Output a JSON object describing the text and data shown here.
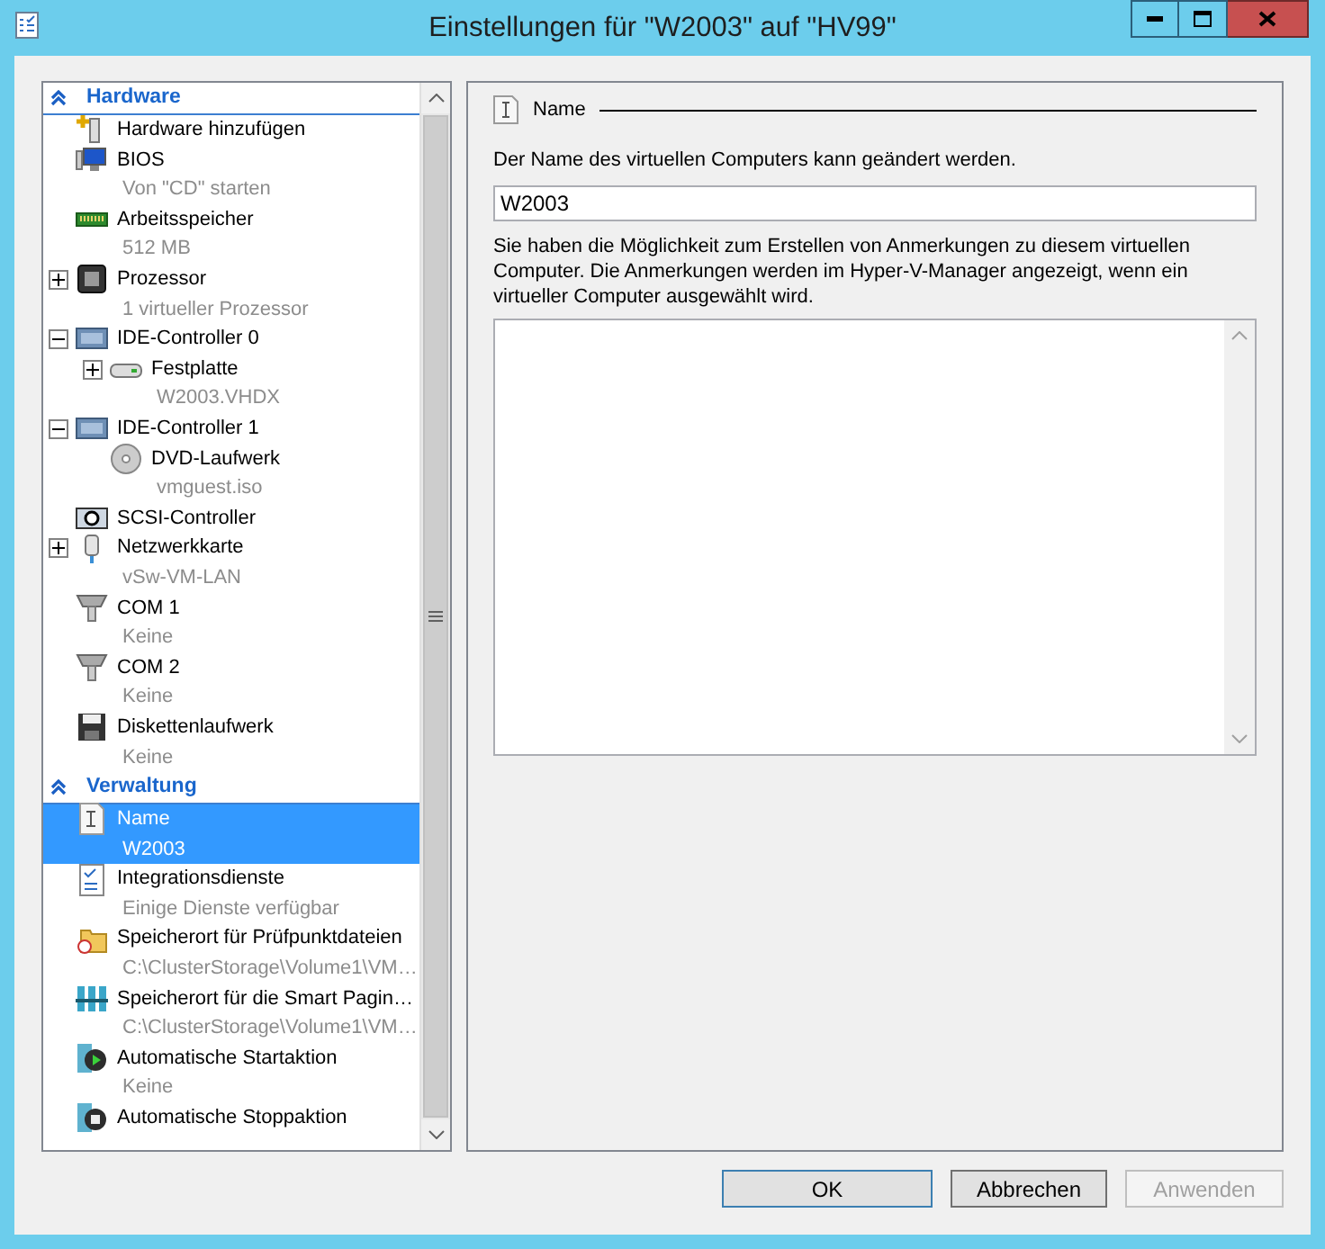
{
  "window": {
    "title": "Einstellungen für \"W2003\" auf \"HV99\""
  },
  "sidebar": {
    "sections": [
      {
        "title": "Hardware",
        "expanded": true,
        "items": [
          {
            "kind": "add-hardware",
            "label": "Hardware hinzufügen",
            "selected": false
          },
          {
            "kind": "bios",
            "label": "BIOS",
            "detail": "Von \"CD\" starten",
            "selected": false
          },
          {
            "kind": "memory",
            "label": "Arbeitsspeicher",
            "detail": "512 MB",
            "selected": false
          },
          {
            "kind": "processor",
            "label": "Prozessor",
            "detail": "1 virtueller Prozessor",
            "expanded": false,
            "selected": false
          },
          {
            "kind": "controller",
            "label": "IDE-Controller 0",
            "expanded": true,
            "selected": false,
            "children": [
              {
                "kind": "disk",
                "label": "Festplatte",
                "detail": "W2003.VHDX",
                "expanded": false,
                "selected": false
              }
            ]
          },
          {
            "kind": "controller",
            "label": "IDE-Controller 1",
            "expanded": true,
            "selected": false,
            "children": [
              {
                "kind": "dvd",
                "label": "DVD-Laufwerk",
                "detail": "vmguest.iso",
                "selected": false
              }
            ]
          },
          {
            "kind": "scsi",
            "label": "SCSI-Controller",
            "selected": false
          },
          {
            "kind": "network",
            "label": "Netzwerkkarte",
            "detail": "vSw-VM-LAN",
            "expanded": false,
            "selected": false
          },
          {
            "kind": "com",
            "label": "COM 1",
            "detail": "Keine",
            "selected": false
          },
          {
            "kind": "com",
            "label": "COM 2",
            "detail": "Keine",
            "selected": false
          },
          {
            "kind": "floppy",
            "label": "Diskettenlaufwerk",
            "detail": "Keine",
            "selected": false
          }
        ]
      },
      {
        "title": "Verwaltung",
        "expanded": true,
        "items": [
          {
            "kind": "name",
            "label": "Name",
            "detail": "W2003",
            "selected": true
          },
          {
            "kind": "integration",
            "label": "Integrationsdienste",
            "detail": "Einige Dienste verfügbar",
            "selected": false
          },
          {
            "kind": "checkpoint",
            "label": "Speicherort für Prüfpunktdateien",
            "detail": "C:\\ClusterStorage\\Volume1\\VM…",
            "selected": false
          },
          {
            "kind": "paging",
            "label": "Speicherort für die Smart Pagin…",
            "detail": "C:\\ClusterStorage\\Volume1\\VM…",
            "selected": false
          },
          {
            "kind": "start",
            "label": "Automatische Startaktion",
            "detail": "Keine",
            "selected": false
          },
          {
            "kind": "stop",
            "label": "Automatische Stoppaktion",
            "selected": false
          }
        ]
      }
    ]
  },
  "detail": {
    "heading": "Name",
    "name_label": "Der Name des virtuellen Computers kann geändert werden.",
    "name_value": "W2003",
    "notes_label": "Sie haben die Möglichkeit zum Erstellen von Anmerkungen zu diesem virtuellen Computer. Die Anmerkungen werden im Hyper-V-Manager angezeigt, wenn ein virtueller Computer ausgewählt wird."
  },
  "buttons": [
    {
      "label": "OK",
      "default": true,
      "disabled": false
    },
    {
      "label": "Abbrechen",
      "default": false,
      "disabled": false
    },
    {
      "label": "Anwenden",
      "default": false,
      "disabled": true
    }
  ]
}
